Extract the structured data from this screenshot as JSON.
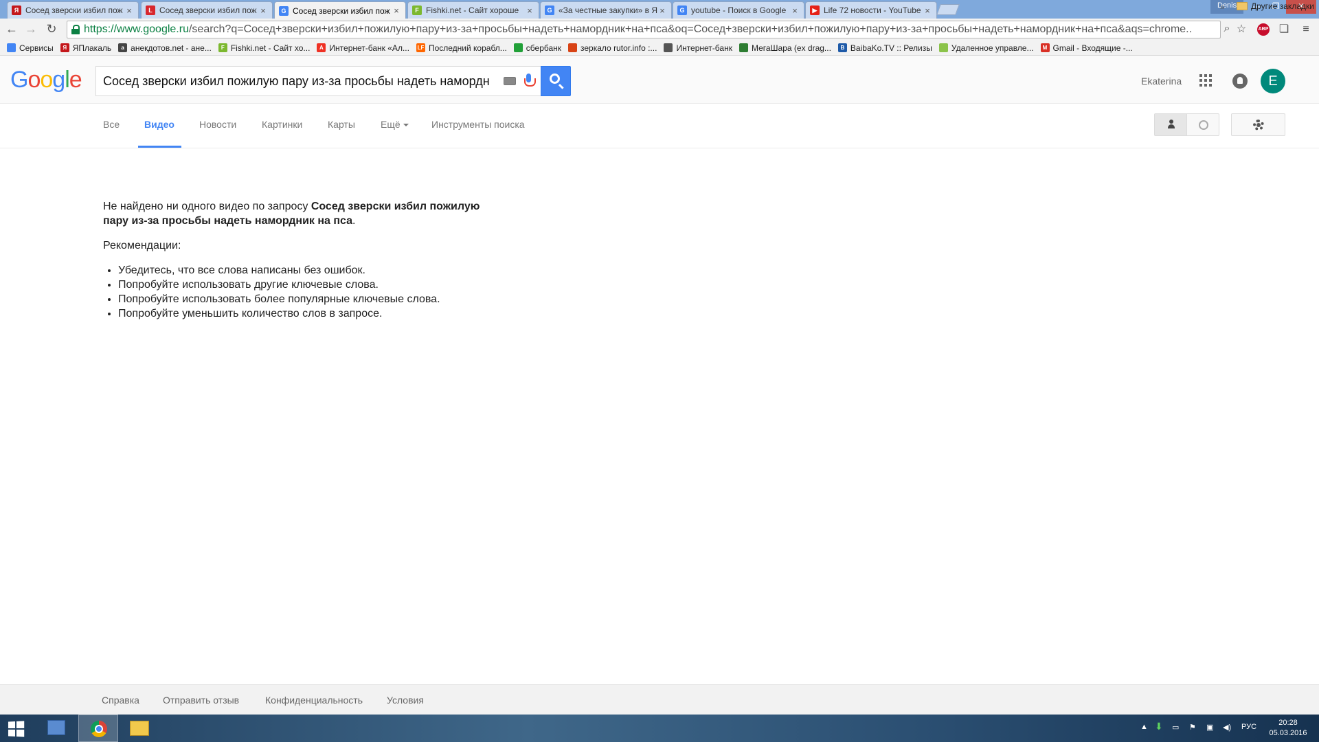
{
  "browser": {
    "tabs": [
      {
        "title": "Сосед зверски избил пож",
        "fav_color": "#c4171b",
        "fav_text": "Я",
        "active": false
      },
      {
        "title": "Сосед зверски избил пож",
        "fav_color": "#d8272e",
        "fav_text": "L",
        "active": false
      },
      {
        "title": "Сосед зверски избил пож",
        "fav_color": "#4285f4",
        "fav_text": "G",
        "active": true
      },
      {
        "title": "Fishki.net - Сайт хороше",
        "fav_color": "#7cb82f",
        "fav_text": "F",
        "active": false
      },
      {
        "title": "«За честные закупки» в Я",
        "fav_color": "#4285f4",
        "fav_text": "G",
        "active": false
      },
      {
        "title": "youtube - Поиск в Google",
        "fav_color": "#4285f4",
        "fav_text": "G",
        "active": false
      },
      {
        "title": "Life 72 новости - YouTube",
        "fav_color": "#e62117",
        "fav_text": "▶",
        "active": false
      }
    ],
    "close_glyph": "×",
    "window_user": "Denis",
    "url_host": "https://www.google.ru",
    "url_rest": "/search?q=Сосед+зверски+избил+пожилую+пару+из-за+просьбы+надеть+намордник+на+пса&oq=Сосед+зверски+избил+пожилую+пару+из-за+просьбы+надеть+намордник+на+пса&aqs=chrome..",
    "abp_label": "ABP"
  },
  "bookmarks": [
    {
      "label": "Сервисы",
      "color": "#4285f4",
      "text": ""
    },
    {
      "label": "ЯПлакаль",
      "color": "#c4171b",
      "text": "Я"
    },
    {
      "label": "анекдотов.net - ане...",
      "color": "#444444",
      "text": "а"
    },
    {
      "label": "Fishki.net - Сайт хо...",
      "color": "#7cb82f",
      "text": "F"
    },
    {
      "label": "Интернет-банк «Ал...",
      "color": "#ef3124",
      "text": "А"
    },
    {
      "label": "Последний корабл...",
      "color": "#ff6600",
      "text": "LF"
    },
    {
      "label": "сбербанк",
      "color": "#21a038",
      "text": ""
    },
    {
      "label": "зеркало rutor.info :...",
      "color": "#d84315",
      "text": ""
    },
    {
      "label": "Интернет-банк",
      "color": "#555555",
      "text": ""
    },
    {
      "label": "МегаШара (ex drag...",
      "color": "#2e7d32",
      "text": ""
    },
    {
      "label": "BaibaKo.TV :: Релизы",
      "color": "#1e5aa8",
      "text": "B"
    },
    {
      "label": "Удаленное управле...",
      "color": "#8bc34a",
      "text": ""
    },
    {
      "label": "Gmail - Входящие -...",
      "color": "#d93025",
      "text": "M"
    }
  ],
  "bookmarks_more": "»",
  "bookmarks_other": "Другие закладки",
  "google": {
    "logo_letters": [
      {
        "ch": "G",
        "color": "#4285f4"
      },
      {
        "ch": "o",
        "color": "#ea4335"
      },
      {
        "ch": "o",
        "color": "#fbbc05"
      },
      {
        "ch": "g",
        "color": "#4285f4"
      },
      {
        "ch": "l",
        "color": "#34a853"
      },
      {
        "ch": "e",
        "color": "#ea4335"
      }
    ],
    "query": "Сосед зверски избил пожилую пару из-за просьбы надеть намордн",
    "user_name": "Ekaterina",
    "avatar_letter": "E"
  },
  "nav": {
    "items": [
      "Все",
      "Видео",
      "Новости",
      "Картинки",
      "Карты",
      "Ещё",
      "Инструменты поиска"
    ],
    "selected": "Видео"
  },
  "results": {
    "no_results_prefix": "Не найдено ни одного видео по запросу ",
    "no_results_query": "Сосед зверски избил пожилую пару из-за просьбы надеть намордник на пса",
    "no_results_suffix": ".",
    "recommendations_title": "Рекомендации:",
    "recommendations": [
      "Убедитесь, что все слова написаны без ошибок.",
      "Попробуйте использовать другие ключевые слова.",
      "Попробуйте использовать более популярные ключевые слова.",
      "Попробуйте уменьшить количество слов в запросе."
    ]
  },
  "footer": {
    "links": [
      "Справка",
      "Отправить отзыв",
      "Конфиденциальность",
      "Условия"
    ]
  },
  "taskbar": {
    "tray_lang": "РУС",
    "time": "20:28",
    "date": "05.03.2016"
  }
}
